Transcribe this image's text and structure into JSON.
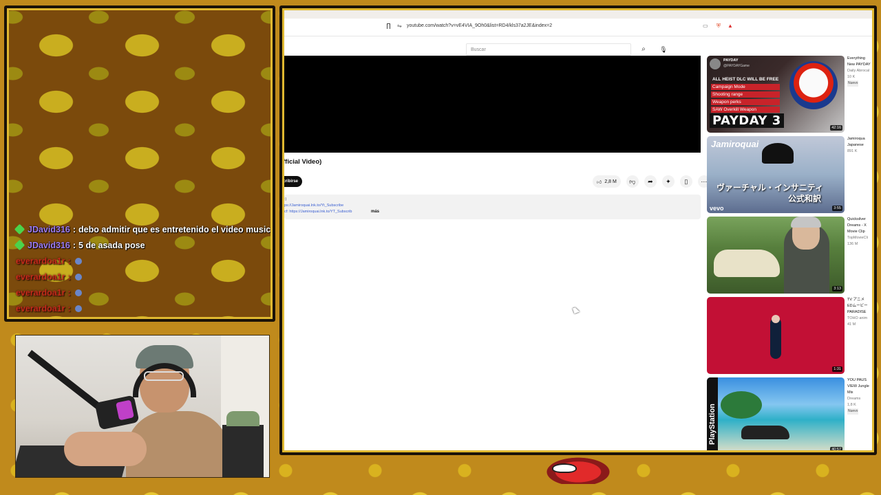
{
  "chat": {
    "messages": [
      {
        "user": "JDavid316",
        "separator": ":",
        "text": "debo admitir que es entretenido el video musical",
        "user_color": "#9e7df5",
        "badge": true
      },
      {
        "user": "JDavid316",
        "separator": ":",
        "text": "5 de asada pose",
        "user_color": "#9e7df5",
        "badge": true
      },
      {
        "user": "everardoa1r",
        "separator": ":",
        "text": "",
        "user_color": "#e0301e",
        "badge": false
      },
      {
        "user": "everardoa1r",
        "separator": ":",
        "text": "",
        "user_color": "#e0301e",
        "badge": false
      },
      {
        "user": "everardoa1r",
        "separator": ":",
        "text": "",
        "user_color": "#e0301e",
        "badge": false
      },
      {
        "user": "everardoa1r",
        "separator": ":",
        "text": "",
        "user_color": "#e0301e",
        "badge": false
      }
    ]
  },
  "browser": {
    "url": "youtube.com/watch?v=vE4VIA_9Oh0&list=RD4/kls37a2JE&index=2",
    "search_placeholder": "Buscar"
  },
  "video": {
    "title": "fficial Video)",
    "subscribe_label": "cribirse",
    "like_count": "2,8 M",
    "description": {
      "line1": ":)",
      "line2": "ps://Jamiroquai.lnk.to/Yt_Subscribe",
      "line3": "cf: https://Jamiroquai.lnk.to/YT_Subscrib",
      "more": "más"
    }
  },
  "recommendations": [
    {
      "title": "Everything New PAYDAY",
      "channel": "Daily Abrocal",
      "stats": "10 K",
      "badge": "Nuevo",
      "duration": "42:16",
      "thumb": {
        "channel_name": "PAYDAY",
        "handle": "@PAYDAYGame",
        "items": [
          "ALL HEIST DLC WILL BE FREE",
          "Campaign Mode",
          "Shooting range",
          "Weapon perks",
          "SAW Overkill Weapon"
        ],
        "logo": "PAYDAY 3"
      }
    },
    {
      "title": "Jamiroqua Japanese",
      "channel": "",
      "stats": "891 K",
      "badge": "",
      "duration": "3:55",
      "thumb": {
        "logo": "Jamiroquai",
        "jp_line1": "ヴァーチャル・インサニティ",
        "jp_line2": "公式和訳",
        "vevo": "vevo"
      }
    },
    {
      "title": "Quicksilver Dreams - X Movie Clip",
      "channel": "TopMovieCli",
      "stats": "136 M",
      "badge": "",
      "duration": "3:13"
    },
    {
      "title": "TV アニメ EDムービー PARADISE",
      "channel": "TOHO anim",
      "stats": "41 M",
      "badge": "",
      "duration": "1:31"
    },
    {
      "title": "YOU PAUS VIEW Jungle Mix",
      "channel": "Dreams",
      "stats": "1,8 K",
      "badge": "Nuevo",
      "duration": "40:57",
      "thumb": {
        "side_label": "PlayStation"
      }
    }
  ]
}
